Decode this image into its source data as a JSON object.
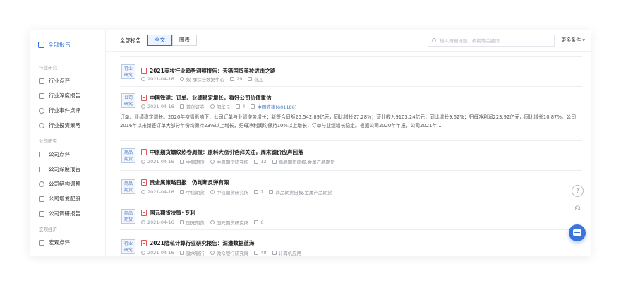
{
  "sidebar": {
    "top": "全部报告",
    "groups": [
      {
        "label": "行业研究",
        "items": [
          "行业点评",
          "行业深度报告",
          "行业事件点评",
          "行业投资策略"
        ]
      },
      {
        "label": "公司研究",
        "items": [
          "公司点评",
          "公司深度报告",
          "公司结构调整",
          "公司增发配股",
          "公司调研报告"
        ]
      },
      {
        "label": "宏观经济",
        "items": [
          "宏观点评"
        ]
      }
    ]
  },
  "toolbar": {
    "title": "全部报告",
    "tabs": [
      "全文",
      "图表"
    ],
    "search_placeholder": "输入研报标题、机构等关键词",
    "more": "更多条件 ▾"
  },
  "reports": [
    {
      "tag1": "行业",
      "tag2": "研究",
      "title": "2021美妆行业趋势洞察报告：天猫国货美妆进击之路",
      "date": "2021-04-16",
      "author": "蚁-群综合数据中心",
      "pages": "29",
      "category": "化工"
    },
    {
      "tag1": "公司",
      "tag2": "研究",
      "title": "中国铁建：订单、业绩稳定增长，看好公司价值重估",
      "date": "2021-04-16",
      "org": "首创证券",
      "author": "邹华元",
      "pages": "4",
      "stock": "中国铁建(601186)",
      "abstract": "订单、业绩稳定增长。2020年疫情影响下，公司订单与业绩逆势增长；新签合同额25,542.89亿元，同比增长27.28%；营业收入9103.24亿元，同比增长9.62%；归母净利润223.92亿元，同比增长10.87%。公司2016年以来新签订单大部分年份均保持23%以上增长，归母净利润均保持10%以上增长，订单与业绩增长稳定。根据公司2020年年报，公司2021年..."
    },
    {
      "tag1": "商品",
      "tag2": "期货",
      "title": "中原期货螺纹热卷周报：原料大涨引爸拜关注，周末钢价应声回落",
      "date": "2021-04-16",
      "org": "中原期货",
      "author": "中原期货研究所",
      "pages": "12",
      "category": "商品期货周报,金属产品期货"
    },
    {
      "tag1": "商品",
      "tag2": "期货",
      "title": "贵金属策略日报：仍判断反弹有限",
      "date": "2021-04-16",
      "org": "中信期货",
      "author": "中信期货研究所",
      "pages": "7",
      "category": "商品期货日报,金属产品期货"
    },
    {
      "tag1": "商品",
      "tag2": "期货",
      "title": "国元期货决策•专利",
      "date": "2021-04-16",
      "org": "国元期货",
      "author": "国元期货研究所",
      "pages": "6"
    },
    {
      "tag1": "行业",
      "tag2": "研究",
      "title": "2021隐私计算行业研究报告：深潜数据蓝海",
      "date": "2021-04-16",
      "org": "微众银行",
      "author": "微众银行研究院",
      "pages": "48",
      "category": "计算机应用"
    }
  ],
  "fab": {
    "help": "?",
    "chat": "chat-icon"
  }
}
